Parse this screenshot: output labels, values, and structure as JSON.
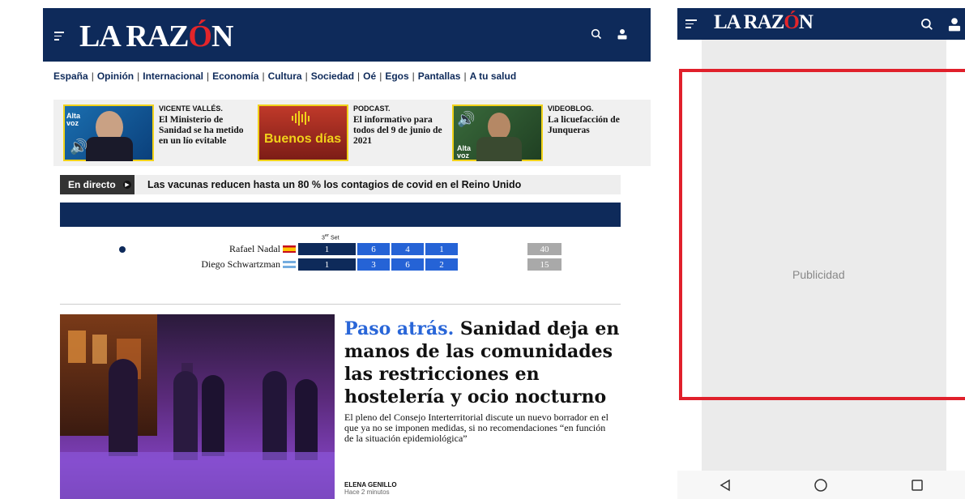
{
  "desktop": {
    "logo_main": "LA RAZ",
    "logo_accent": "Ó",
    "logo_end": "N",
    "nav": [
      "España",
      "Opinión",
      "Internacional",
      "Economía",
      "Cultura",
      "Sociedad",
      "Oé",
      "Egos",
      "Pantallas",
      "A tu salud"
    ],
    "nav_sep": "|",
    "promos": [
      {
        "label": "VICENTE VALLÉS.",
        "text": "El Ministerio de Sanidad se ha metido en un lío evitable",
        "thumb_tag": "Alta voz"
      },
      {
        "label": "PODCAST.",
        "text": "El informativo para todos del 9 de junio de 2021",
        "thumb_tag": "Buenos días"
      },
      {
        "label": "VIDEOBLOG.",
        "text": "La licuefacción de Junqueras",
        "thumb_tag": "Alta voz"
      }
    ],
    "live": {
      "tag": "En directo",
      "text": "Las vacunas reducen hasta un 80 % los contagios de covid en el Reino Unido"
    },
    "score": {
      "set_label_main": "3",
      "set_label_sup": "er",
      "set_label_rest": " Set",
      "players": [
        {
          "name": "Rafael Nadal",
          "set3": "1",
          "sets": [
            "6",
            "4",
            "1"
          ],
          "points": "40"
        },
        {
          "name": "Diego Schwartzman",
          "set3": "1",
          "sets": [
            "3",
            "6",
            "2"
          ],
          "points": "15"
        }
      ]
    },
    "article": {
      "kicker": "Paso atrás.",
      "headline": "Sanidad deja en manos de las comunidades las restricciones en hostelería y ocio nocturno",
      "summary": "El pleno del Consejo Interterritorial discute un nuevo borrador en el que ya no se imponen medidas, si no recomendaciones “en función de la situación epidemiológica”",
      "author": "ELENA GENILLO",
      "time": "Hace 2 minutos"
    }
  },
  "mobile": {
    "logo_main": "LA RAZ",
    "logo_accent": "Ó",
    "logo_end": "N",
    "ad_label": "Publicidad"
  },
  "colors": {
    "brand": "#0e2a5a",
    "accent": "#e3252a",
    "kicker": "#2966d8",
    "score_blue": "#2563d6",
    "ad_border": "#e0202b"
  }
}
